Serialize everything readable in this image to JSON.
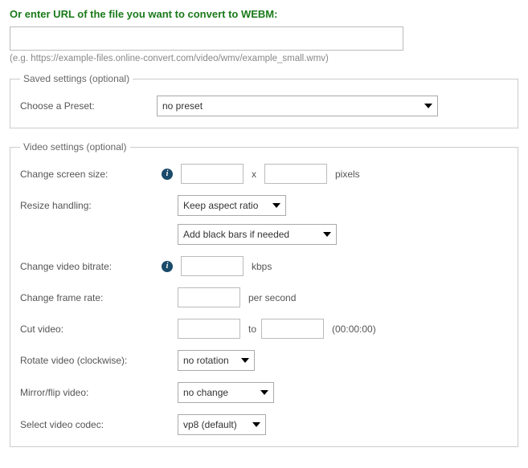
{
  "title": "Or enter URL of the file you want to convert to WEBM:",
  "url_input": {
    "value": ""
  },
  "example_hint": "(e.g. https://example-files.online-convert.com/video/wmv/example_small.wmv)",
  "saved_settings": {
    "legend": "Saved settings (optional)",
    "preset_label": "Choose a Preset:",
    "preset_value": "no preset"
  },
  "video_settings": {
    "legend": "Video settings (optional)",
    "screen_size_label": "Change screen size:",
    "width": "",
    "x_sep": "x",
    "height": "",
    "pixels_unit": "pixels",
    "resize_label": "Resize handling:",
    "resize_aspect": "Keep aspect ratio",
    "resize_bars": "Add black bars if needed",
    "bitrate_label": "Change video bitrate:",
    "bitrate_value": "",
    "bitrate_unit": "kbps",
    "framerate_label": "Change frame rate:",
    "framerate_value": "",
    "framerate_unit": "per second",
    "cut_label": "Cut video:",
    "cut_from": "",
    "cut_to_sep": "to",
    "cut_to": "",
    "cut_hint": "(00:00:00)",
    "rotate_label": "Rotate video (clockwise):",
    "rotate_value": "no rotation",
    "mirror_label": "Mirror/flip video:",
    "mirror_value": "no change",
    "codec_label": "Select video codec:",
    "codec_value": "vp8 (default)"
  }
}
